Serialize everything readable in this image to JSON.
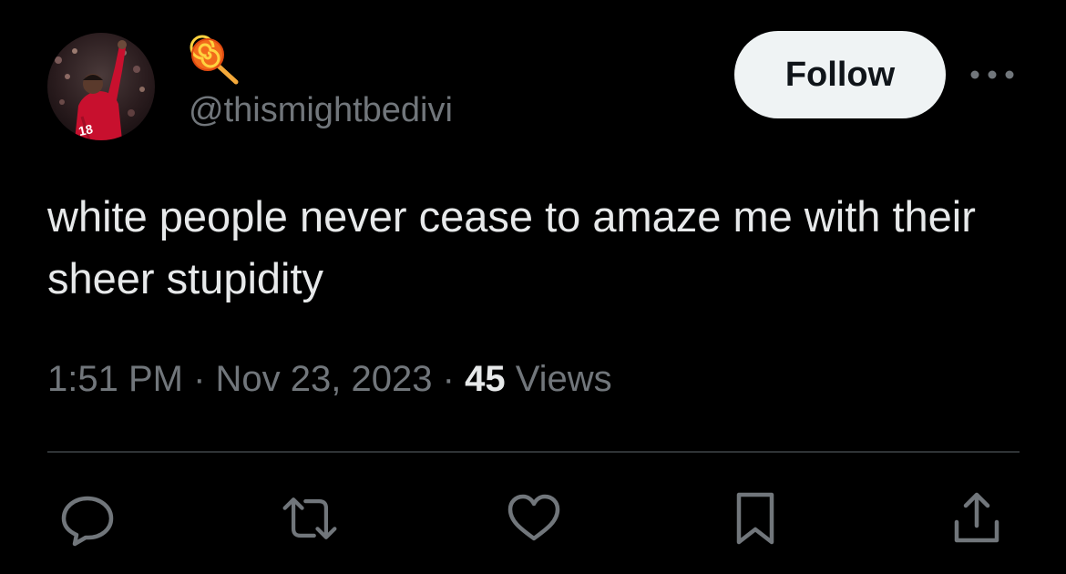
{
  "user": {
    "handle": "@thismightbedivi",
    "name_icon": "lollipop-icon",
    "avatar_icon": "profile-photo-soccer-player"
  },
  "header": {
    "follow_label": "Follow",
    "more_icon": "more-options-icon"
  },
  "tweet": {
    "text": "white people never cease to amaze me with their sheer stupidity",
    "time": "1:51 PM",
    "separator": "·",
    "date": "Nov 23, 2023",
    "views_count": "45",
    "views_label": "Views"
  },
  "actions": [
    {
      "icon": "reply-icon"
    },
    {
      "icon": "retweet-icon"
    },
    {
      "icon": "like-icon"
    },
    {
      "icon": "bookmark-icon"
    },
    {
      "icon": "share-icon"
    }
  ],
  "colors": {
    "background": "#000000",
    "primary_text": "#e7e9ea",
    "secondary_text": "#71767b",
    "follow_bg": "#eff3f4",
    "divider": "#2f3336"
  }
}
